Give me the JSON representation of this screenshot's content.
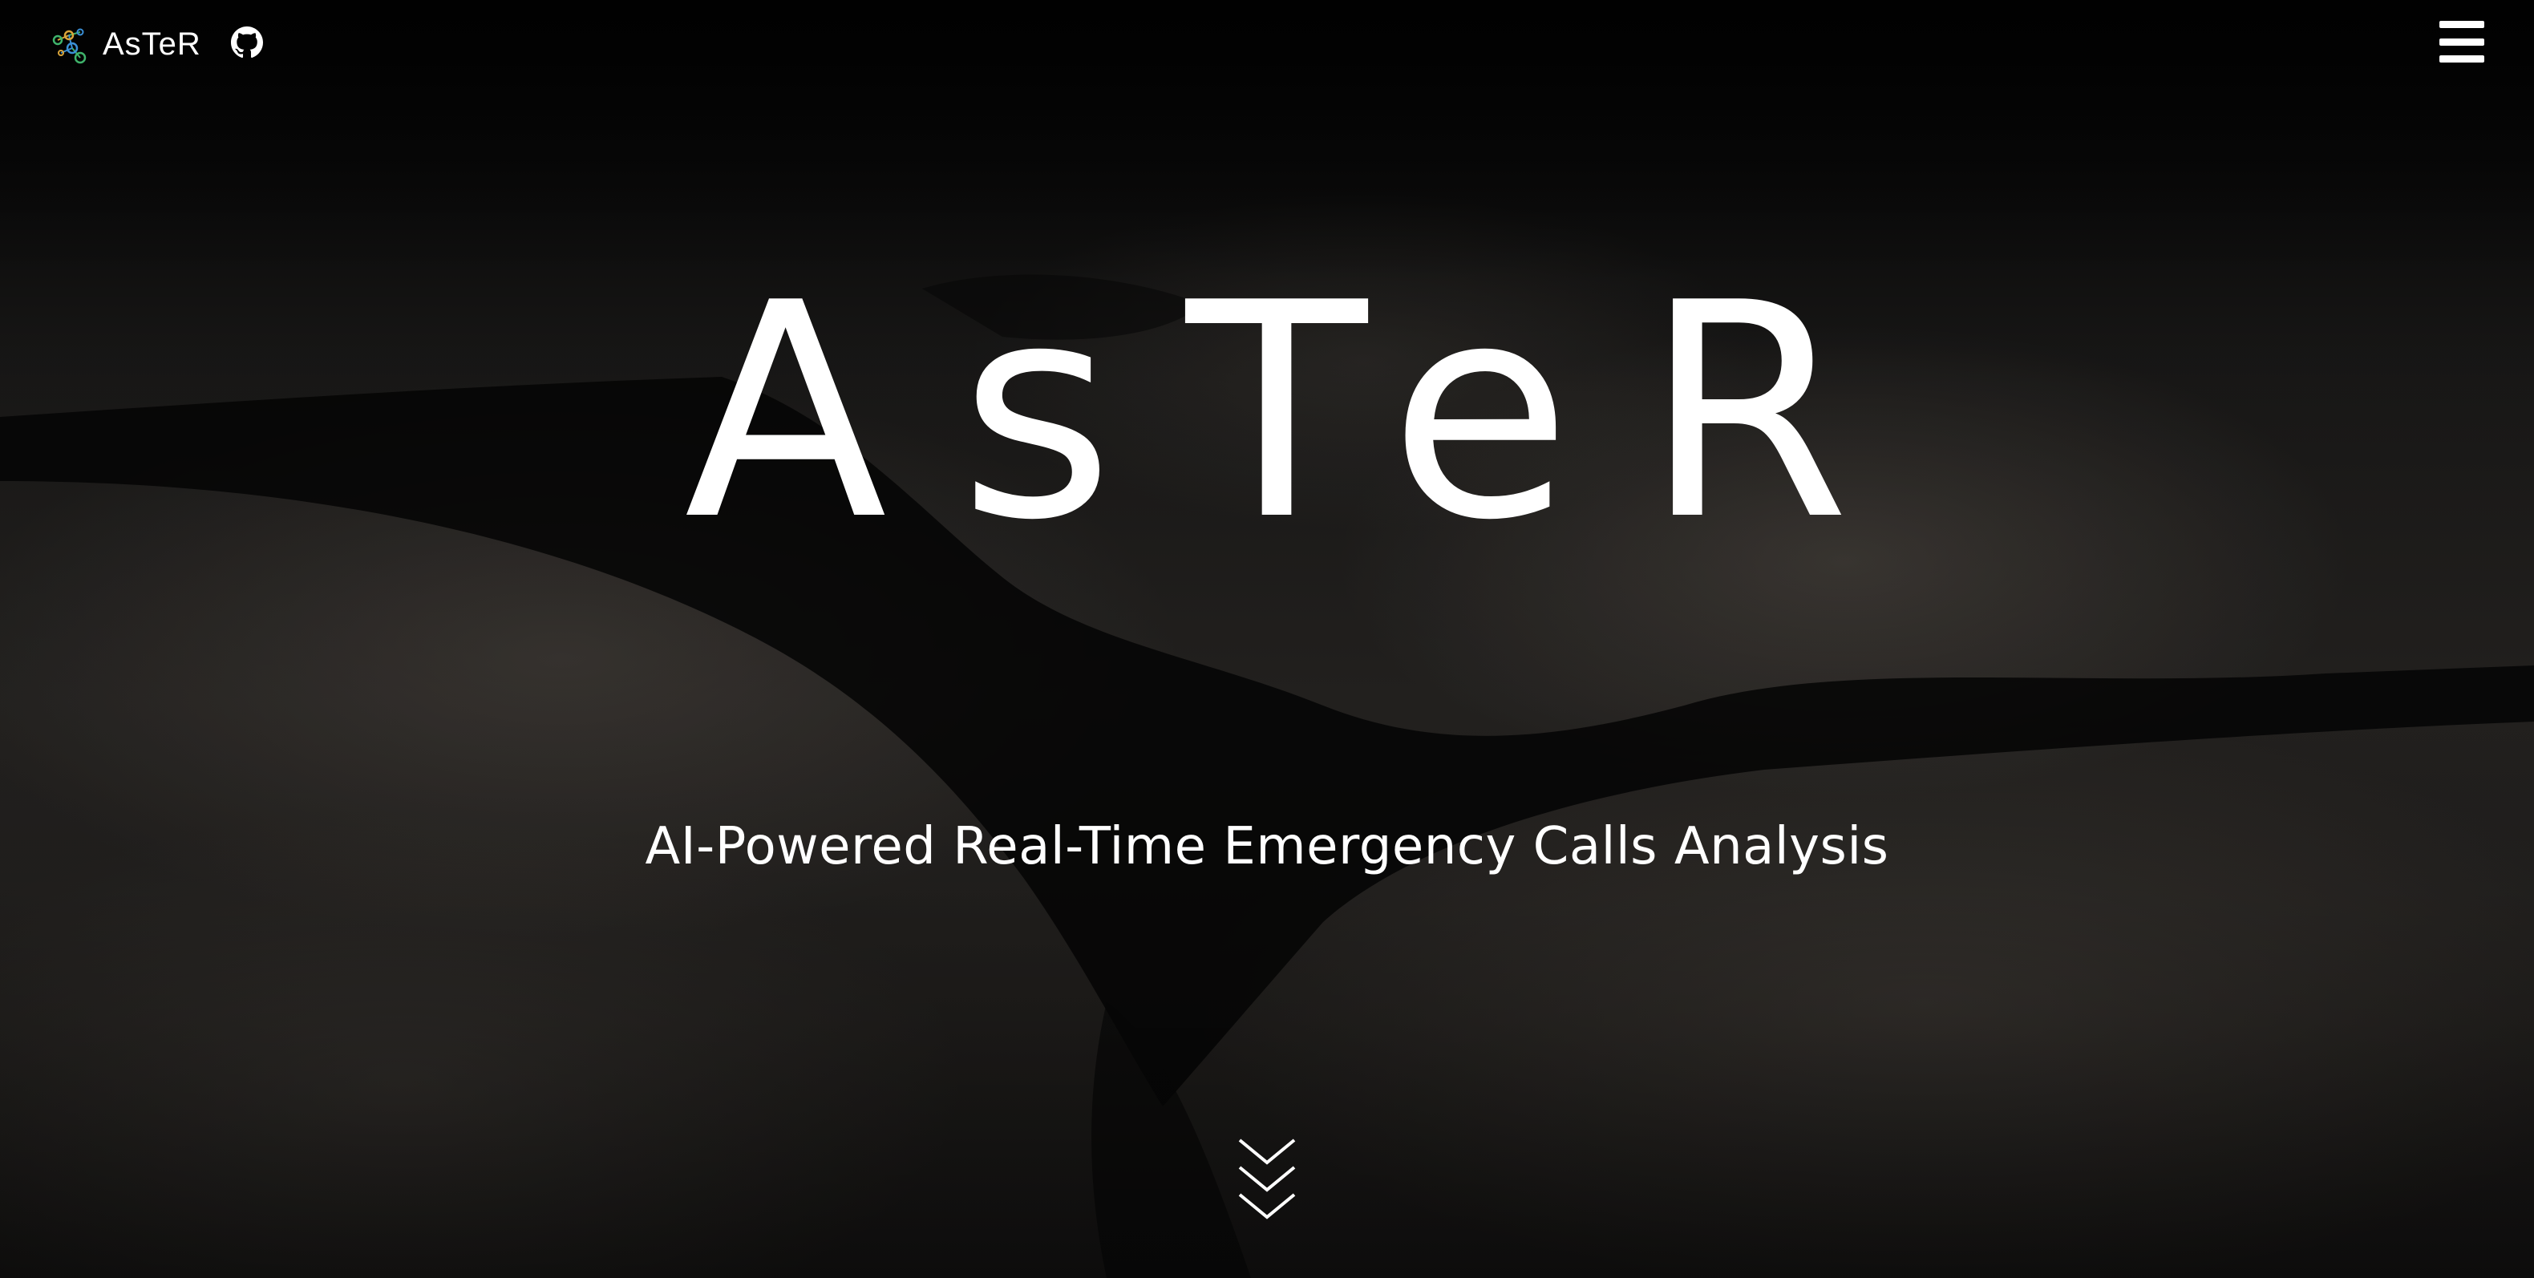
{
  "navbar": {
    "brand_name": "AsTeR",
    "brand_logo_icon": "molecule-logo-icon",
    "github_icon": "github-icon",
    "menu_icon": "hamburger-menu-icon"
  },
  "hero": {
    "title": "AsTeR",
    "subtitle": "AI-Powered Real-Time Emergency Calls Analysis",
    "scroll_icon": "chevrons-down-icon"
  },
  "colors": {
    "text": "#ffffff",
    "background": "#1e1c1a",
    "logo_green": "#3fb36b",
    "logo_blue": "#3a8fd6",
    "logo_gold": "#d9a43a"
  }
}
